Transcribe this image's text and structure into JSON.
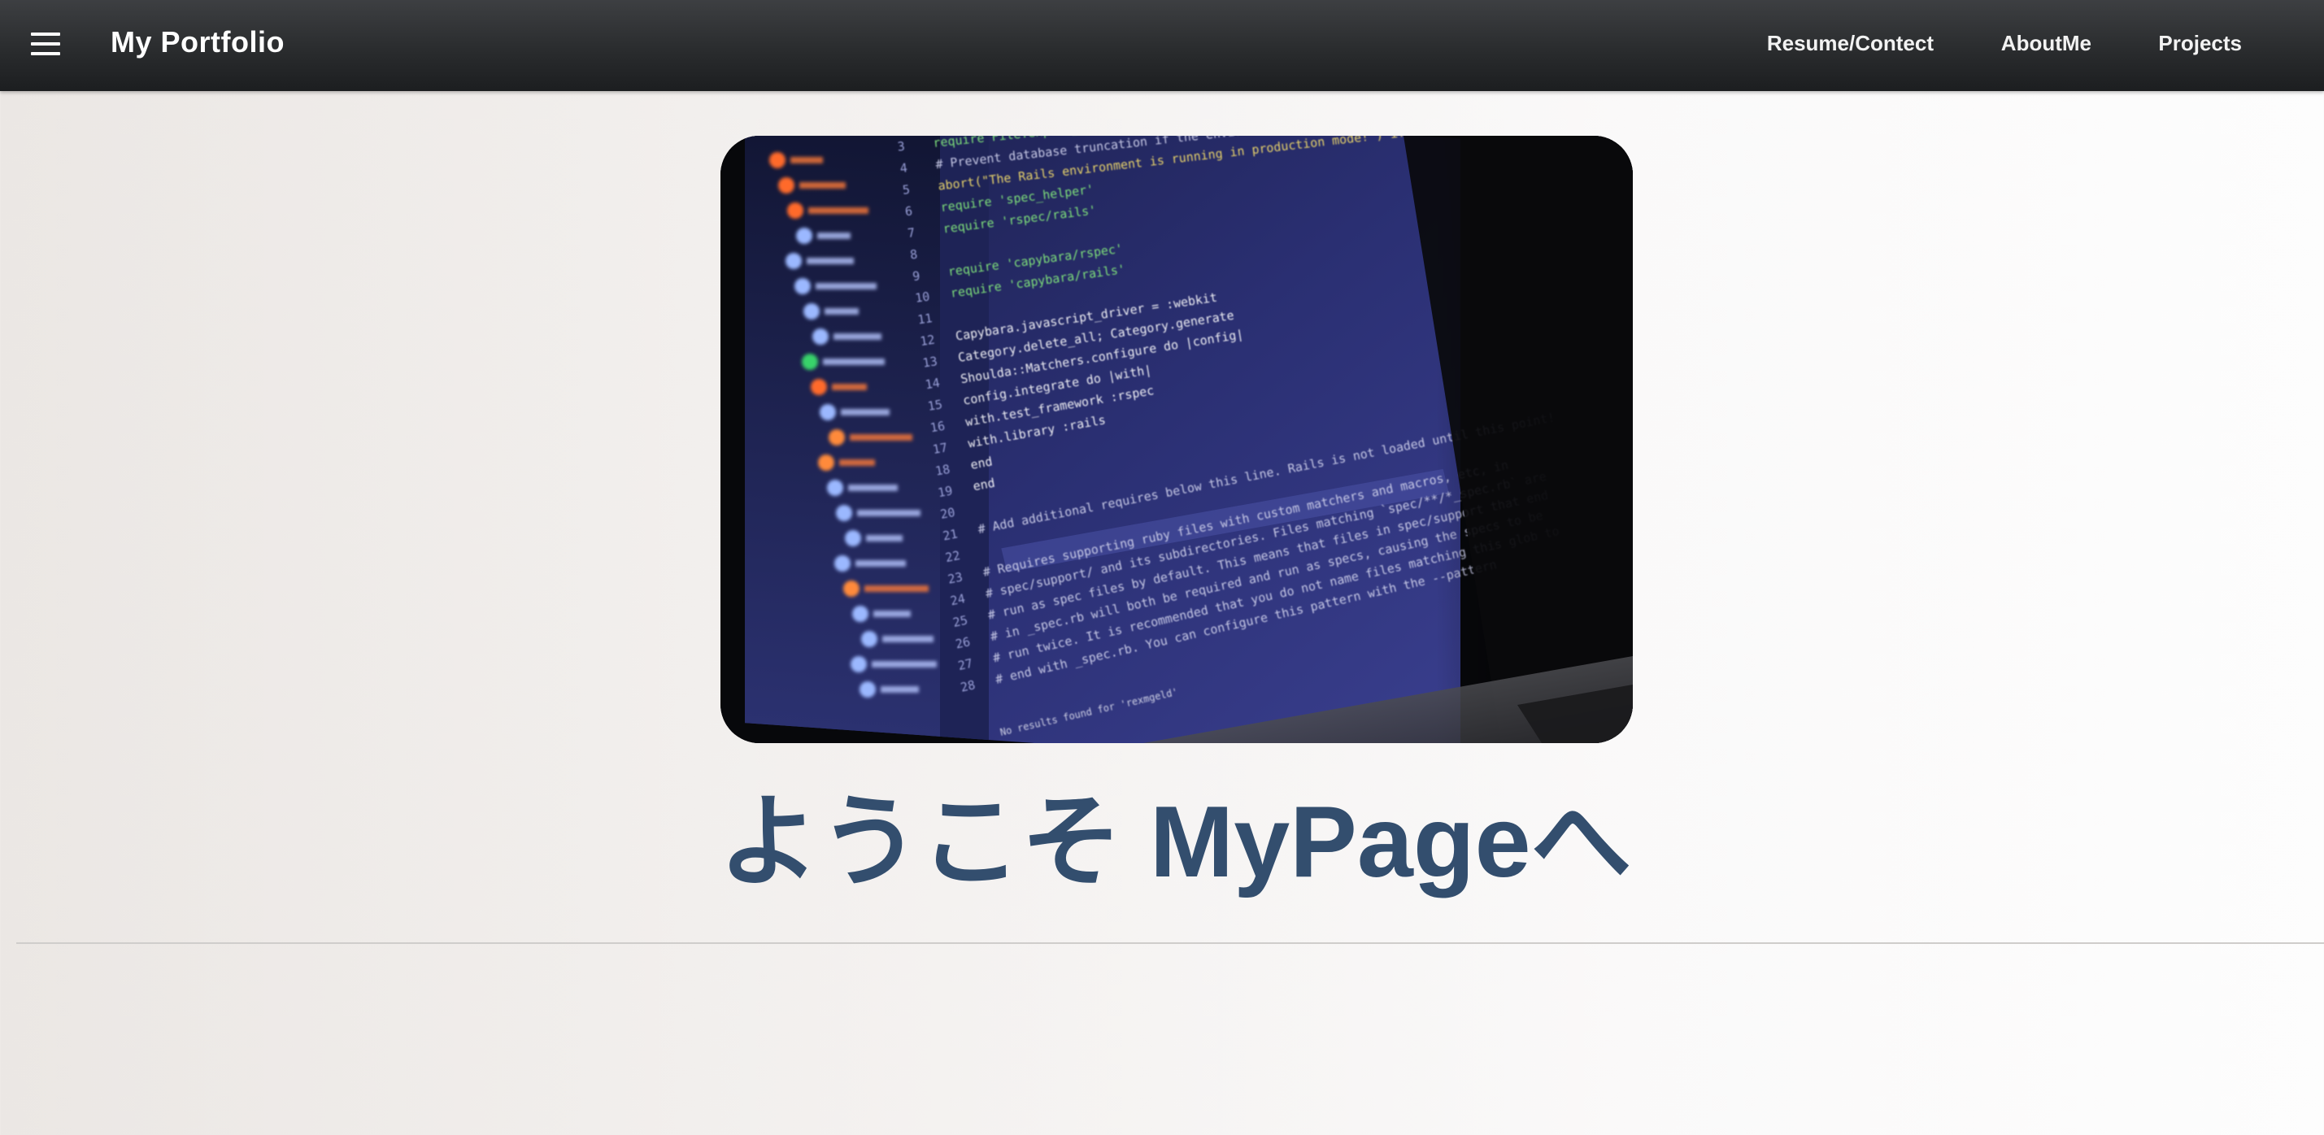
{
  "navbar": {
    "menu_icon": "hamburger-menu-icon",
    "brand": "My Portfolio",
    "links": [
      {
        "label": "Resume/Contect"
      },
      {
        "label": "AboutMe"
      },
      {
        "label": "Projects"
      }
    ]
  },
  "hero": {
    "image": "laptop-code-editor-photo",
    "code_lines": [
      {
        "num": "3",
        "text": "require File.expand_path('../../config/environment', __FILE__)"
      },
      {
        "num": "4",
        "text": "# Prevent database truncation if the environment is production"
      },
      {
        "num": "5",
        "text": "abort(\"The Rails environment is running in production mode!\") if Rails.env.production?"
      },
      {
        "num": "6",
        "text": "require 'spec_helper'"
      },
      {
        "num": "7",
        "text": "require 'rspec/rails'"
      },
      {
        "num": "8",
        "text": ""
      },
      {
        "num": "9",
        "text": "require 'capybara/rspec'"
      },
      {
        "num": "10",
        "text": "require 'capybara/rails'"
      },
      {
        "num": "11",
        "text": ""
      },
      {
        "num": "12",
        "text": "Capybara.javascript_driver = :webkit"
      },
      {
        "num": "13",
        "text": "Category.delete_all; Category.generate"
      },
      {
        "num": "14",
        "text": "Shoulda::Matchers.configure do |config|"
      },
      {
        "num": "15",
        "text": "  config.integrate do |with|"
      },
      {
        "num": "16",
        "text": "    with.test_framework :rspec"
      },
      {
        "num": "17",
        "text": "    with.library :rails"
      },
      {
        "num": "18",
        "text": "  end"
      },
      {
        "num": "19",
        "text": "end"
      },
      {
        "num": "20",
        "text": ""
      },
      {
        "num": "21",
        "text": "# Add additional requires below this line. Rails is not loaded until this point!"
      },
      {
        "num": "22",
        "text": ""
      },
      {
        "num": "23",
        "text": "# Requires supporting ruby files with custom matchers and macros, etc, in"
      },
      {
        "num": "24",
        "text": "# spec/support/ and its subdirectories. Files matching `spec/**/*_spec.rb` are"
      },
      {
        "num": "25",
        "text": "# run as spec files by default. This means that files in spec/support that end"
      },
      {
        "num": "26",
        "text": "# in _spec.rb will both be required and run as specs, causing the specs to be"
      },
      {
        "num": "27",
        "text": "# run twice. It is recommended that you do not name files matching this glob to"
      },
      {
        "num": "28",
        "text": "# end with _spec.rb. You can configure this pattern with the --pattern"
      }
    ],
    "search_status": "No results found for 'rexmgeld'"
  },
  "main": {
    "welcome": "ようこそ MyPageへ"
  },
  "colors": {
    "navbar": "#2a2c2e",
    "heading": "#334e6e",
    "background": "#f2efed"
  }
}
